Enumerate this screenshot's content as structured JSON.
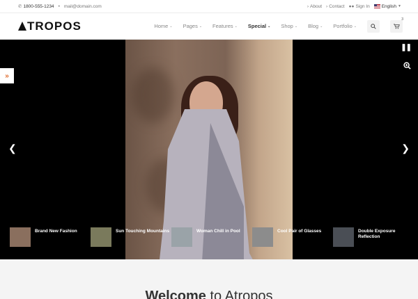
{
  "topbar": {
    "phone": "1800-555-1234",
    "separator": "•",
    "email": "mail@domain.com",
    "links": [
      "About",
      "Contact",
      "Sign In"
    ],
    "language": "English"
  },
  "header": {
    "logo": "TROPOS",
    "nav": [
      {
        "label": "Home",
        "special": false
      },
      {
        "label": "Pages",
        "special": false
      },
      {
        "label": "Features",
        "special": false
      },
      {
        "label": "Special",
        "special": true
      },
      {
        "label": "Shop",
        "special": false
      },
      {
        "label": "Blog",
        "special": false
      },
      {
        "label": "Portfolio",
        "special": false
      }
    ],
    "cart_count": "3"
  },
  "slider": {
    "thumbs": [
      {
        "caption": "Brand New Fashion",
        "color": "#8a6f5e"
      },
      {
        "caption": "Sun Touching Mountains",
        "color": "#7a7a5c"
      },
      {
        "caption": "Woman Chill in Pool",
        "color": "#9aa3a8"
      },
      {
        "caption": "Cool Pair of Glasses",
        "color": "#8c8c8c"
      },
      {
        "caption": "Double Exposure Reflection",
        "color": "#4a4e55"
      }
    ]
  },
  "welcome": {
    "bold": "Welcome",
    "rest": " to Atropos"
  }
}
